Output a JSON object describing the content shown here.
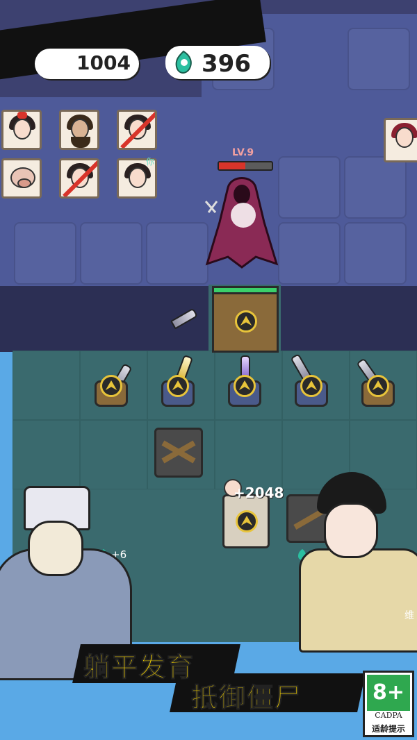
{
  "hud": {
    "gem_count": "396",
    "gem_icon": "teal-gem-icon",
    "left_counter_partial": "1004"
  },
  "roster": {
    "self_label": "你",
    "players": [
      {
        "name": "girl-red-bow",
        "eliminated": false
      },
      {
        "name": "bearded-man",
        "eliminated": false
      },
      {
        "name": "girl-long-hair",
        "eliminated": true
      },
      {
        "name": "pig-face",
        "eliminated": false
      },
      {
        "name": "girl-twin-buns",
        "eliminated": true
      },
      {
        "name": "girl-self",
        "eliminated": false
      }
    ]
  },
  "enemy": {
    "level_label": "LV.9",
    "hp_fraction": 0.5,
    "hp_color": "#d8342a"
  },
  "board": {
    "bonus_amount": "+2048",
    "pickup_left": "+6",
    "pickup_right": "4",
    "side_char_partial": "维"
  },
  "banner": {
    "line1": "躺平发育",
    "line2": "抵御僵尸"
  },
  "age_rating": {
    "rating": "8+",
    "org": "CADPA",
    "tip": "适龄提示",
    "color": "#2fa84f"
  }
}
